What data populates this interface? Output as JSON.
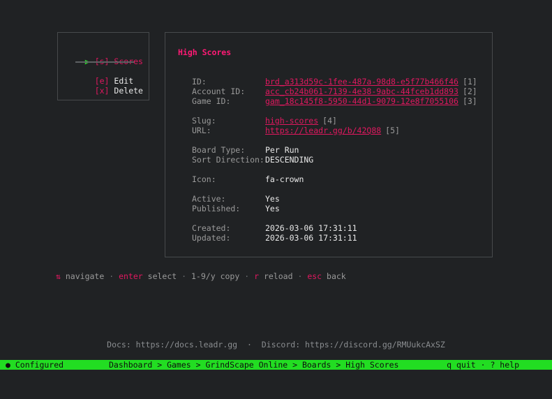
{
  "menu": {
    "items": [
      {
        "key": "[s]",
        "label": "Scores",
        "selected": true
      },
      {
        "key": "[e]",
        "label": "Edit",
        "selected": false
      },
      {
        "key": "[x]",
        "label": "Delete",
        "selected": false
      }
    ],
    "arrow": "▶"
  },
  "detail": {
    "title": "High Scores",
    "fields": {
      "id": {
        "label": "ID:",
        "value": "brd_a313d59c-1fee-487a-98d8-e5f77b466f46",
        "ref": "[1]"
      },
      "account_id": {
        "label": "Account ID:",
        "value": "acc_cb24b061-7139-4e38-9abc-44fceb1dd893",
        "ref": "[2]"
      },
      "game_id": {
        "label": "Game ID:",
        "value": "gam_18c145f8-5950-44d1-9079-12e8f7055106",
        "ref": "[3]"
      },
      "slug": {
        "label": "Slug:",
        "value": "high-scores",
        "ref": "[4]"
      },
      "url": {
        "label": "URL:",
        "value": "https://leadr.gg/b/42Q88",
        "ref": "[5]"
      },
      "board_type": {
        "label": "Board Type:",
        "value": "Per Run"
      },
      "sort_direction": {
        "label": "Sort Direction:",
        "value": "DESCENDING"
      },
      "icon": {
        "label": "Icon:",
        "value": "fa-crown"
      },
      "active": {
        "label": "Active:",
        "value": "Yes"
      },
      "published": {
        "label": "Published:",
        "value": "Yes"
      },
      "created": {
        "label": "Created:",
        "value": "2026-03-06 17:31:11"
      },
      "updated": {
        "label": "Updated:",
        "value": "2026-03-06 17:31:11"
      }
    }
  },
  "helpbar": {
    "nav_glyph": "⇅",
    "nav_label": "navigate",
    "enter_key": "enter",
    "enter_label": "select",
    "copy_key": "1-9/y",
    "copy_label": "copy",
    "reload_key": "r",
    "reload_label": "reload",
    "back_key": "esc",
    "back_label": "back",
    "separator": "·"
  },
  "footer": {
    "docs": "Docs: https://docs.leadr.gg",
    "separator": "·",
    "discord": "Discord: https://discord.gg/RMUukcAxSZ"
  },
  "statusbar": {
    "status": "● Configured",
    "breadcrumb": "Dashboard > Games > GrindScape Online > Boards > High Scores",
    "quit": "q quit",
    "separator": "·",
    "help": "? help"
  },
  "colors": {
    "background": "#202224",
    "accent": "#e0185f",
    "selection_arrow": "#2ed12e",
    "status_bar": "#22dd22"
  }
}
